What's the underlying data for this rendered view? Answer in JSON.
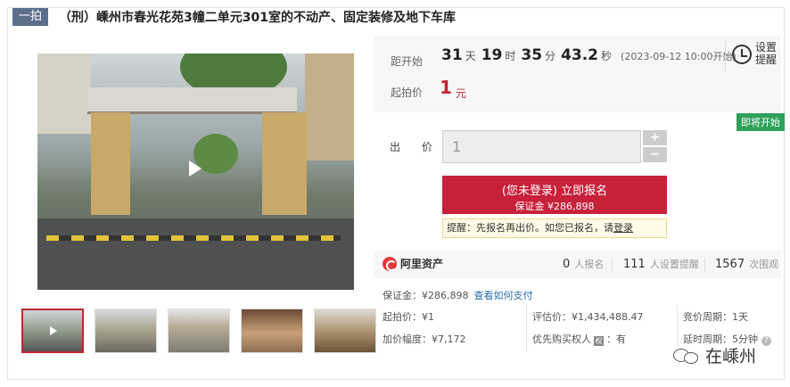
{
  "header": {
    "badge": "一拍",
    "title": "（刑）嵊州市春光花苑3幢二单元301室的不动产、固定装修及地下车库"
  },
  "countdown": {
    "label": "距开始",
    "days": "31",
    "days_unit": "天",
    "hours": "19",
    "hours_unit": "时",
    "minutes": "35",
    "minutes_unit": "分",
    "seconds": "43.2",
    "seconds_unit": "秒",
    "start_note": "(2023-09-12 10:00开始)"
  },
  "remind": {
    "label": "设置提醒"
  },
  "start_price": {
    "label": "起拍价",
    "value": "1",
    "unit": "元"
  },
  "status_tag": "即将开始",
  "bid": {
    "label": "出 价",
    "value": "1",
    "plus": "+",
    "minus": "−"
  },
  "signup": {
    "line1": "(您未登录) 立即报名",
    "line2": "保证金 ¥286,898"
  },
  "tip": {
    "text": "提醒：先报名再出价。如您已报名，请",
    "link": "登录"
  },
  "stats": {
    "brand": "阿里资产",
    "signups": "0",
    "signups_unit": "人报名",
    "reminders": "111",
    "reminders_unit": "人设置提醒",
    "views": "1567",
    "views_unit": "次围观"
  },
  "details": {
    "deposit": "保证金：¥286,898",
    "deposit_link": "查看如何支付",
    "start_price": "起拍价：¥1",
    "appraisal": "评估价：¥1,434,488.47",
    "cycle": "竞价周期：1天",
    "increment": "加价幅度：¥7,172",
    "priority_label": "优先购买权人",
    "priority_icon": "权",
    "priority_value": "：有",
    "delay": "延时周期：5分钟"
  },
  "watermark": {
    "text": "在嵊州"
  }
}
